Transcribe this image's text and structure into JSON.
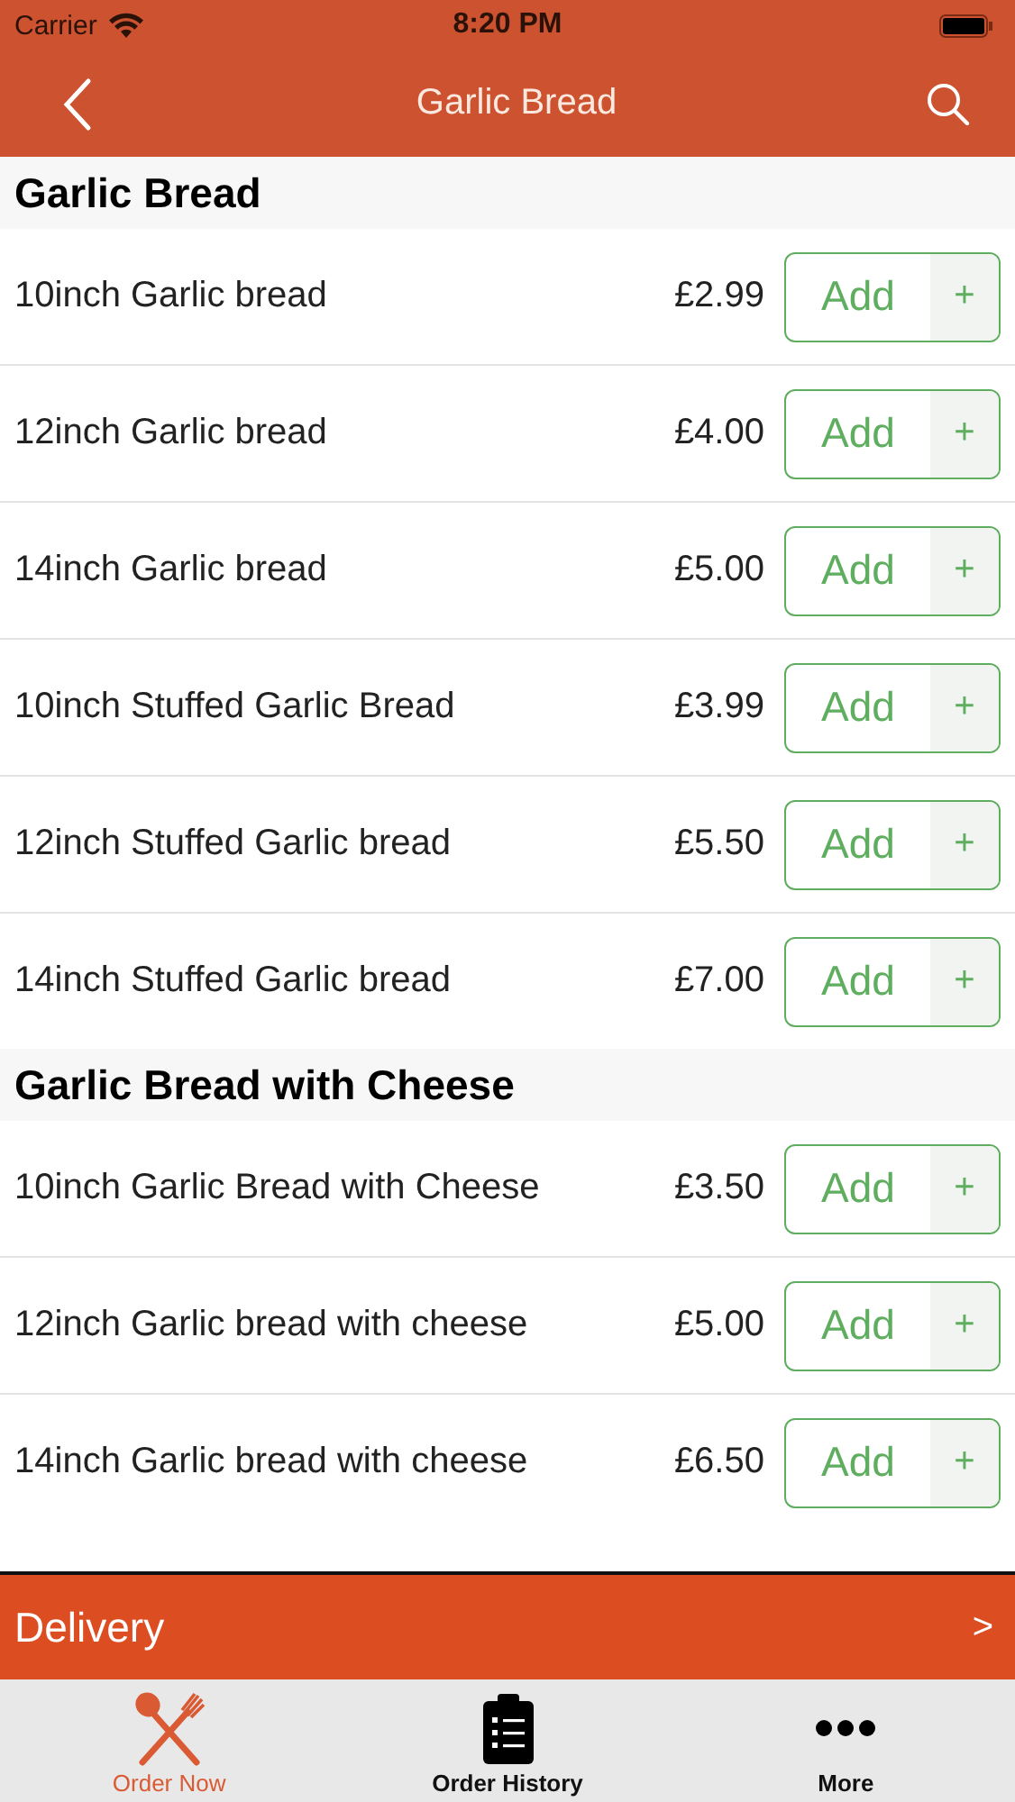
{
  "status_bar": {
    "carrier": "Carrier",
    "time": "8:20 PM"
  },
  "nav": {
    "title": "Garlic Bread"
  },
  "sections": [
    {
      "title": "Garlic Bread",
      "items": [
        {
          "name": "10inch Garlic bread",
          "price": "£2.99",
          "button": "Add",
          "plus": "+"
        },
        {
          "name": "12inch Garlic bread",
          "price": "£4.00",
          "button": "Add",
          "plus": "+"
        },
        {
          "name": "14inch Garlic bread",
          "price": "£5.00",
          "button": "Add",
          "plus": "+"
        },
        {
          "name": "10inch Stuffed Garlic Bread",
          "price": "£3.99",
          "button": "Add",
          "plus": "+"
        },
        {
          "name": "12inch Stuffed Garlic bread",
          "price": "£5.50",
          "button": "Add",
          "plus": "+"
        },
        {
          "name": "14inch Stuffed Garlic bread",
          "price": "£7.00",
          "button": "Add",
          "plus": "+"
        }
      ]
    },
    {
      "title": "Garlic Bread with Cheese",
      "items": [
        {
          "name": "10inch Garlic Bread with Cheese",
          "price": "£3.50",
          "button": "Add",
          "plus": "+"
        },
        {
          "name": "12inch Garlic bread with cheese",
          "price": "£5.00",
          "button": "Add",
          "plus": "+"
        },
        {
          "name": "14inch Garlic bread with cheese",
          "price": "£6.50",
          "button": "Add",
          "plus": "+"
        }
      ]
    }
  ],
  "delivery_bar": {
    "label": "Delivery",
    "arrow": ">"
  },
  "tabs": [
    {
      "label": "Order Now",
      "kind": "cutlery",
      "selected": true
    },
    {
      "label": "Order History",
      "kind": "clipboard",
      "selected": false
    },
    {
      "label": "More",
      "kind": "dots",
      "selected": false
    }
  ]
}
